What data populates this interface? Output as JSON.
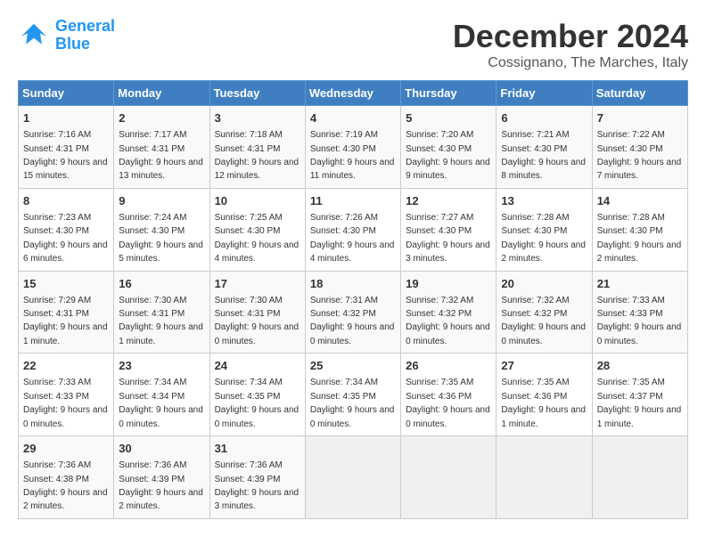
{
  "header": {
    "logo_line1": "General",
    "logo_line2": "Blue",
    "title": "December 2024",
    "subtitle": "Cossignano, The Marches, Italy"
  },
  "calendar": {
    "days_of_week": [
      "Sunday",
      "Monday",
      "Tuesday",
      "Wednesday",
      "Thursday",
      "Friday",
      "Saturday"
    ],
    "weeks": [
      [
        null,
        {
          "day": "2",
          "sunrise": "7:17 AM",
          "sunset": "4:31 PM",
          "daylight": "9 hours and 13 minutes."
        },
        {
          "day": "3",
          "sunrise": "7:18 AM",
          "sunset": "4:31 PM",
          "daylight": "9 hours and 12 minutes."
        },
        {
          "day": "4",
          "sunrise": "7:19 AM",
          "sunset": "4:30 PM",
          "daylight": "9 hours and 11 minutes."
        },
        {
          "day": "5",
          "sunrise": "7:20 AM",
          "sunset": "4:30 PM",
          "daylight": "9 hours and 9 minutes."
        },
        {
          "day": "6",
          "sunrise": "7:21 AM",
          "sunset": "4:30 PM",
          "daylight": "9 hours and 8 minutes."
        },
        {
          "day": "7",
          "sunrise": "7:22 AM",
          "sunset": "4:30 PM",
          "daylight": "9 hours and 7 minutes."
        }
      ],
      [
        {
          "day": "1",
          "sunrise": "7:16 AM",
          "sunset": "4:31 PM",
          "daylight": "9 hours and 15 minutes."
        },
        null,
        null,
        null,
        null,
        null,
        null
      ],
      [
        {
          "day": "8",
          "sunrise": "7:23 AM",
          "sunset": "4:30 PM",
          "daylight": "9 hours and 6 minutes."
        },
        {
          "day": "9",
          "sunrise": "7:24 AM",
          "sunset": "4:30 PM",
          "daylight": "9 hours and 5 minutes."
        },
        {
          "day": "10",
          "sunrise": "7:25 AM",
          "sunset": "4:30 PM",
          "daylight": "9 hours and 4 minutes."
        },
        {
          "day": "11",
          "sunrise": "7:26 AM",
          "sunset": "4:30 PM",
          "daylight": "9 hours and 4 minutes."
        },
        {
          "day": "12",
          "sunrise": "7:27 AM",
          "sunset": "4:30 PM",
          "daylight": "9 hours and 3 minutes."
        },
        {
          "day": "13",
          "sunrise": "7:28 AM",
          "sunset": "4:30 PM",
          "daylight": "9 hours and 2 minutes."
        },
        {
          "day": "14",
          "sunrise": "7:28 AM",
          "sunset": "4:30 PM",
          "daylight": "9 hours and 2 minutes."
        }
      ],
      [
        {
          "day": "15",
          "sunrise": "7:29 AM",
          "sunset": "4:31 PM",
          "daylight": "9 hours and 1 minute."
        },
        {
          "day": "16",
          "sunrise": "7:30 AM",
          "sunset": "4:31 PM",
          "daylight": "9 hours and 1 minute."
        },
        {
          "day": "17",
          "sunrise": "7:30 AM",
          "sunset": "4:31 PM",
          "daylight": "9 hours and 0 minutes."
        },
        {
          "day": "18",
          "sunrise": "7:31 AM",
          "sunset": "4:32 PM",
          "daylight": "9 hours and 0 minutes."
        },
        {
          "day": "19",
          "sunrise": "7:32 AM",
          "sunset": "4:32 PM",
          "daylight": "9 hours and 0 minutes."
        },
        {
          "day": "20",
          "sunrise": "7:32 AM",
          "sunset": "4:32 PM",
          "daylight": "9 hours and 0 minutes."
        },
        {
          "day": "21",
          "sunrise": "7:33 AM",
          "sunset": "4:33 PM",
          "daylight": "9 hours and 0 minutes."
        }
      ],
      [
        {
          "day": "22",
          "sunrise": "7:33 AM",
          "sunset": "4:33 PM",
          "daylight": "9 hours and 0 minutes."
        },
        {
          "day": "23",
          "sunrise": "7:34 AM",
          "sunset": "4:34 PM",
          "daylight": "9 hours and 0 minutes."
        },
        {
          "day": "24",
          "sunrise": "7:34 AM",
          "sunset": "4:35 PM",
          "daylight": "9 hours and 0 minutes."
        },
        {
          "day": "25",
          "sunrise": "7:34 AM",
          "sunset": "4:35 PM",
          "daylight": "9 hours and 0 minutes."
        },
        {
          "day": "26",
          "sunrise": "7:35 AM",
          "sunset": "4:36 PM",
          "daylight": "9 hours and 0 minutes."
        },
        {
          "day": "27",
          "sunrise": "7:35 AM",
          "sunset": "4:36 PM",
          "daylight": "9 hours and 1 minute."
        },
        {
          "day": "28",
          "sunrise": "7:35 AM",
          "sunset": "4:37 PM",
          "daylight": "9 hours and 1 minute."
        }
      ],
      [
        {
          "day": "29",
          "sunrise": "7:36 AM",
          "sunset": "4:38 PM",
          "daylight": "9 hours and 2 minutes."
        },
        {
          "day": "30",
          "sunrise": "7:36 AM",
          "sunset": "4:39 PM",
          "daylight": "9 hours and 2 minutes."
        },
        {
          "day": "31",
          "sunrise": "7:36 AM",
          "sunset": "4:39 PM",
          "daylight": "9 hours and 3 minutes."
        },
        null,
        null,
        null,
        null
      ]
    ]
  }
}
